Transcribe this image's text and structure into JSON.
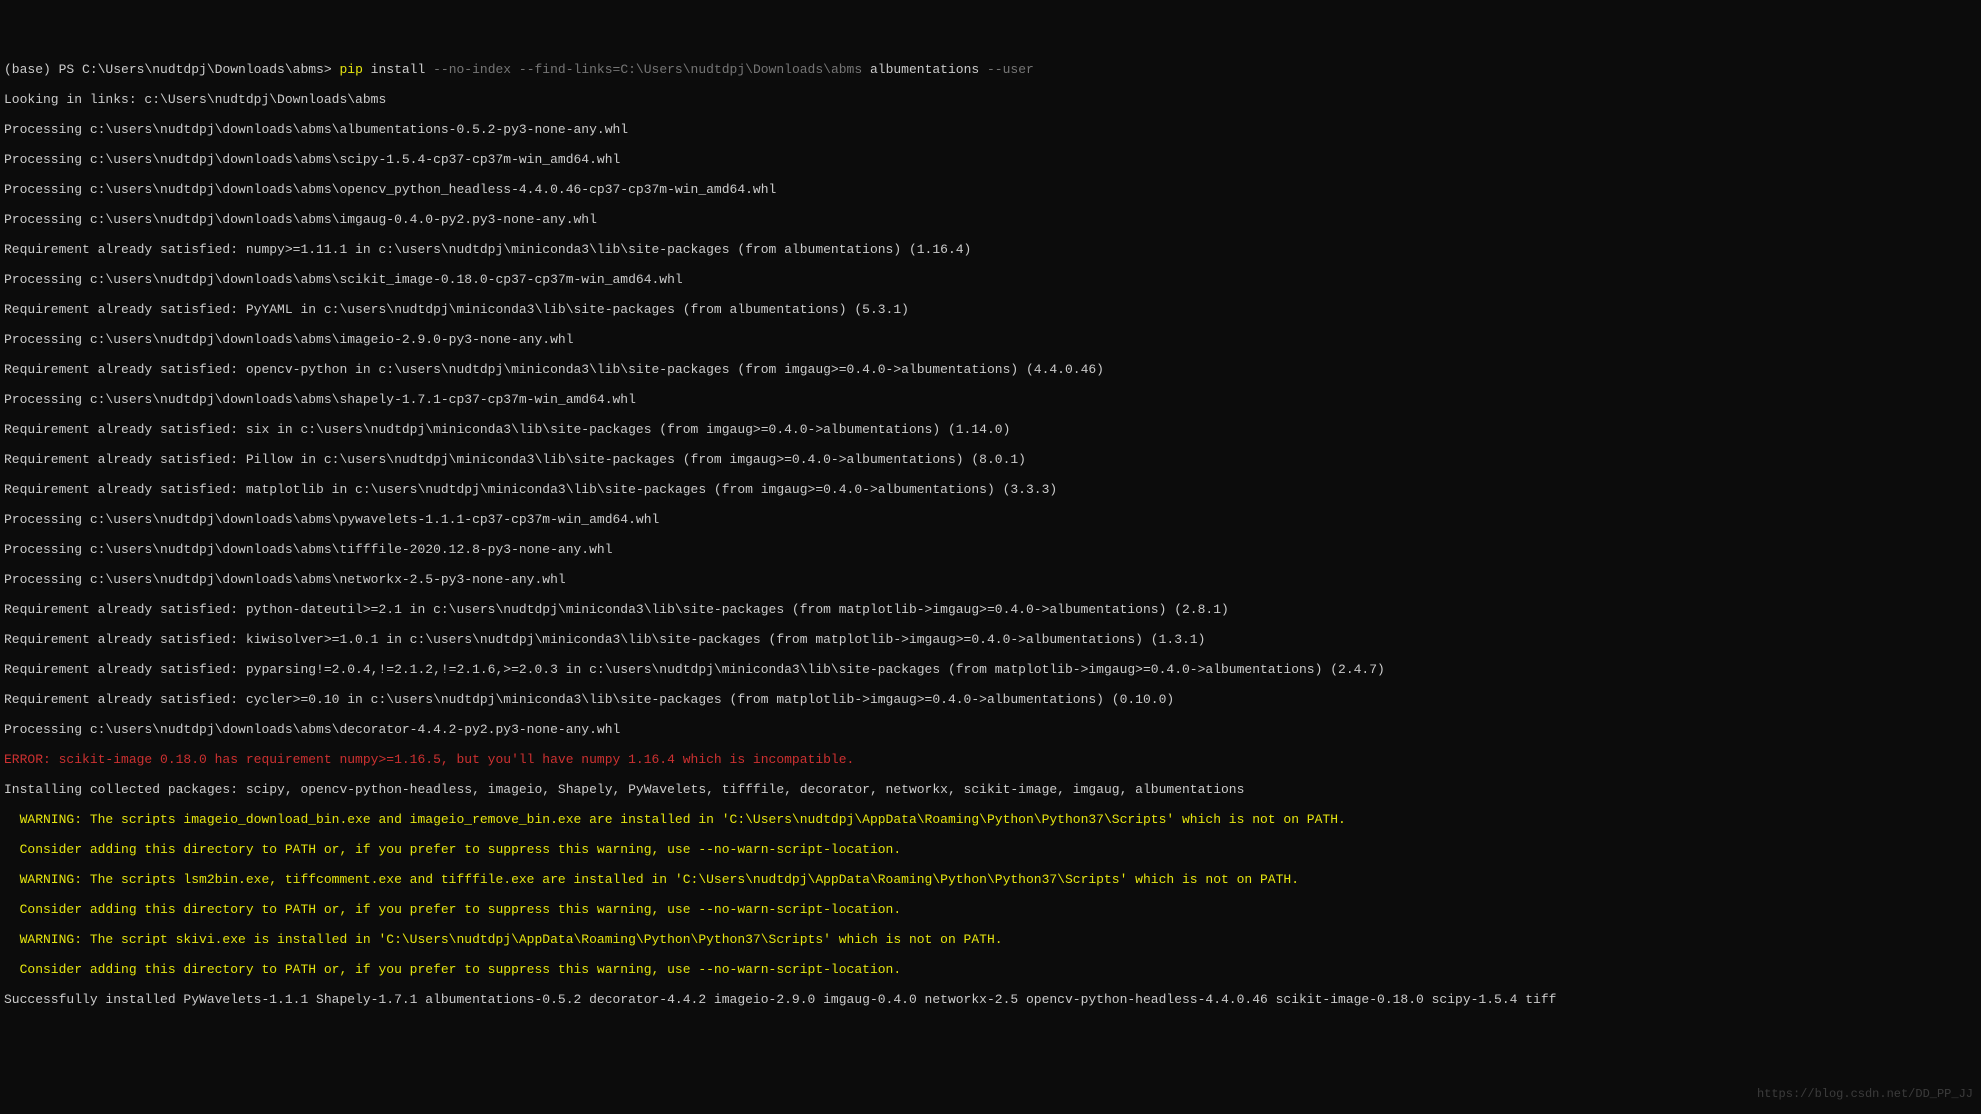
{
  "prompt": {
    "env": "(base) ",
    "shell": "PS ",
    "path": "C:\\Users\\nudtdpj\\Downloads\\abms> ",
    "cmd_pip": "pip",
    "cmd_install": " install ",
    "cmd_flags": "--no-index --find-links=C:\\Users\\nudtdpj\\Downloads\\abms ",
    "cmd_pkg": "albumentations ",
    "cmd_user": "--user"
  },
  "lines": {
    "l01": "Looking in links: c:\\Users\\nudtdpj\\Downloads\\abms",
    "l02": "Processing c:\\users\\nudtdpj\\downloads\\abms\\albumentations-0.5.2-py3-none-any.whl",
    "l03": "Processing c:\\users\\nudtdpj\\downloads\\abms\\scipy-1.5.4-cp37-cp37m-win_amd64.whl",
    "l04": "Processing c:\\users\\nudtdpj\\downloads\\abms\\opencv_python_headless-4.4.0.46-cp37-cp37m-win_amd64.whl",
    "l05": "Processing c:\\users\\nudtdpj\\downloads\\abms\\imgaug-0.4.0-py2.py3-none-any.whl",
    "l06": "Requirement already satisfied: numpy>=1.11.1 in c:\\users\\nudtdpj\\miniconda3\\lib\\site-packages (from albumentations) (1.16.4)",
    "l07": "Processing c:\\users\\nudtdpj\\downloads\\abms\\scikit_image-0.18.0-cp37-cp37m-win_amd64.whl",
    "l08": "Requirement already satisfied: PyYAML in c:\\users\\nudtdpj\\miniconda3\\lib\\site-packages (from albumentations) (5.3.1)",
    "l09": "Processing c:\\users\\nudtdpj\\downloads\\abms\\imageio-2.9.0-py3-none-any.whl",
    "l10": "Requirement already satisfied: opencv-python in c:\\users\\nudtdpj\\miniconda3\\lib\\site-packages (from imgaug>=0.4.0->albumentations) (4.4.0.46)",
    "l11": "Processing c:\\users\\nudtdpj\\downloads\\abms\\shapely-1.7.1-cp37-cp37m-win_amd64.whl",
    "l12": "Requirement already satisfied: six in c:\\users\\nudtdpj\\miniconda3\\lib\\site-packages (from imgaug>=0.4.0->albumentations) (1.14.0)",
    "l13": "Requirement already satisfied: Pillow in c:\\users\\nudtdpj\\miniconda3\\lib\\site-packages (from imgaug>=0.4.0->albumentations) (8.0.1)",
    "l14": "Requirement already satisfied: matplotlib in c:\\users\\nudtdpj\\miniconda3\\lib\\site-packages (from imgaug>=0.4.0->albumentations) (3.3.3)",
    "l15": "Processing c:\\users\\nudtdpj\\downloads\\abms\\pywavelets-1.1.1-cp37-cp37m-win_amd64.whl",
    "l16": "Processing c:\\users\\nudtdpj\\downloads\\abms\\tifffile-2020.12.8-py3-none-any.whl",
    "l17": "Processing c:\\users\\nudtdpj\\downloads\\abms\\networkx-2.5-py3-none-any.whl",
    "l18": "Requirement already satisfied: python-dateutil>=2.1 in c:\\users\\nudtdpj\\miniconda3\\lib\\site-packages (from matplotlib->imgaug>=0.4.0->albumentations) (2.8.1)",
    "l19": "Requirement already satisfied: kiwisolver>=1.0.1 in c:\\users\\nudtdpj\\miniconda3\\lib\\site-packages (from matplotlib->imgaug>=0.4.0->albumentations) (1.3.1)",
    "l20": "Requirement already satisfied: pyparsing!=2.0.4,!=2.1.2,!=2.1.6,>=2.0.3 in c:\\users\\nudtdpj\\miniconda3\\lib\\site-packages (from matplotlib->imgaug>=0.4.0->albumentations) (2.4.7)",
    "l21": "Requirement already satisfied: cycler>=0.10 in c:\\users\\nudtdpj\\miniconda3\\lib\\site-packages (from matplotlib->imgaug>=0.4.0->albumentations) (0.10.0)",
    "l22": "Processing c:\\users\\nudtdpj\\downloads\\abms\\decorator-4.4.2-py2.py3-none-any.whl",
    "l23": "ERROR: scikit-image 0.18.0 has requirement numpy>=1.16.5, but you'll have numpy 1.16.4 which is incompatible.",
    "l24": "Installing collected packages: scipy, opencv-python-headless, imageio, Shapely, PyWavelets, tifffile, decorator, networkx, scikit-image, imgaug, albumentations",
    "l25": "  WARNING: The scripts imageio_download_bin.exe and imageio_remove_bin.exe are installed in 'C:\\Users\\nudtdpj\\AppData\\Roaming\\Python\\Python37\\Scripts' which is not on PATH.",
    "l26": "  Consider adding this directory to PATH or, if you prefer to suppress this warning, use --no-warn-script-location.",
    "l27": "  WARNING: The scripts lsm2bin.exe, tiffcomment.exe and tifffile.exe are installed in 'C:\\Users\\nudtdpj\\AppData\\Roaming\\Python\\Python37\\Scripts' which is not on PATH.",
    "l28": "  Consider adding this directory to PATH or, if you prefer to suppress this warning, use --no-warn-script-location.",
    "l29": "  WARNING: The script skivi.exe is installed in 'C:\\Users\\nudtdpj\\AppData\\Roaming\\Python\\Python37\\Scripts' which is not on PATH.",
    "l30": "  Consider adding this directory to PATH or, if you prefer to suppress this warning, use --no-warn-script-location.",
    "l31": "Successfully installed PyWavelets-1.1.1 Shapely-1.7.1 albumentations-0.5.2 decorator-4.4.2 imageio-2.9.0 imgaug-0.4.0 networkx-2.5 opencv-python-headless-4.4.0.46 scikit-image-0.18.0 scipy-1.5.4 tiff"
  },
  "watermark": "https://blog.csdn.net/DD_PP_JJ"
}
